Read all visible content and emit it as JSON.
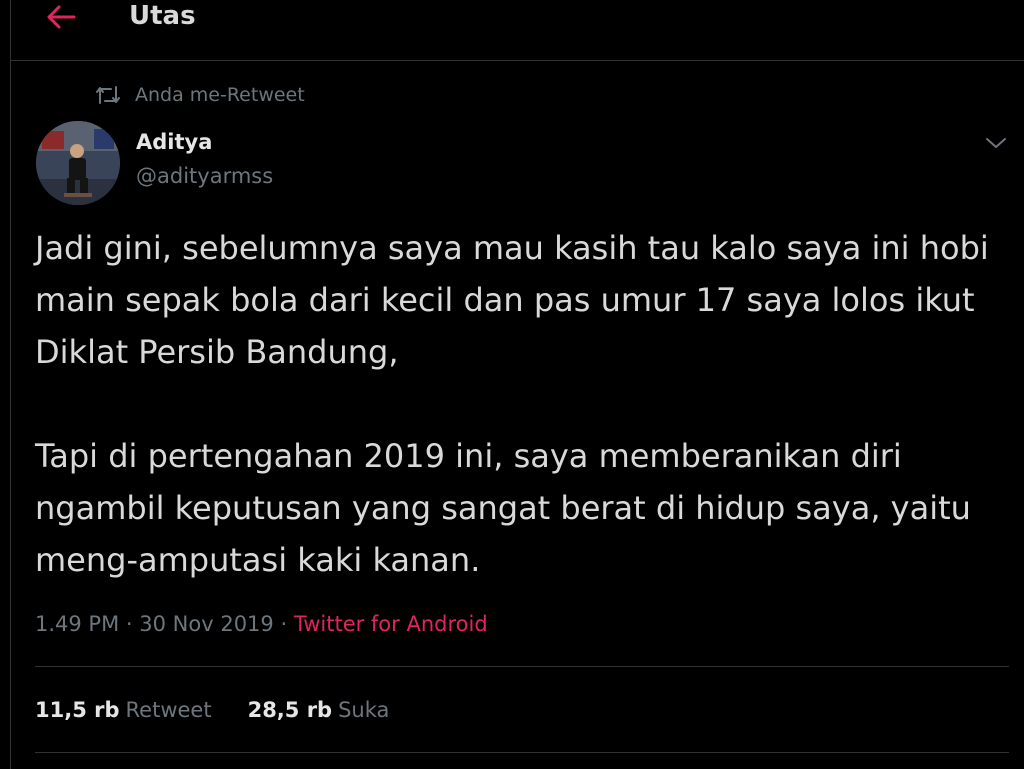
{
  "header": {
    "title": "Utas",
    "back_icon": "arrow-left-icon",
    "accent_color": "#e0245e"
  },
  "retweet_context": {
    "icon": "retweet-icon",
    "text": "Anda me-Retweet"
  },
  "tweet": {
    "author": {
      "name": "Aditya",
      "handle": "@adityarmss",
      "avatar": "avatar-photo"
    },
    "more_icon": "chevron-down-icon",
    "paragraphs": [
      "Jadi gini, sebelumnya saya mau kasih tau kalo saya ini hobi main sepak bola dari kecil dan pas umur 17 saya lolos ikut Diklat Persib Bandung,",
      "Tapi di pertengahan 2019 ini, saya memberanikan diri ngambil keputusan yang sangat berat di hidup saya, yaitu meng-amputasi kaki kanan."
    ],
    "time": "1.49 PM",
    "separator": "·",
    "date": "30 Nov 2019",
    "source": "Twitter for Android",
    "source_color": "#e0245e"
  },
  "stats": {
    "retweets_count": "11,5 rb",
    "retweets_label": "Retweet",
    "likes_count": "28,5 rb",
    "likes_label": "Suka"
  }
}
